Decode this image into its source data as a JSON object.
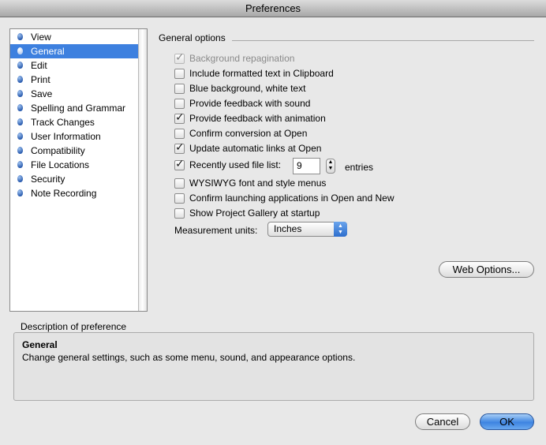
{
  "window": {
    "title": "Preferences"
  },
  "sidebar": {
    "items": [
      {
        "label": "View"
      },
      {
        "label": "General",
        "selected": true
      },
      {
        "label": "Edit"
      },
      {
        "label": "Print"
      },
      {
        "label": "Save"
      },
      {
        "label": "Spelling and Grammar"
      },
      {
        "label": "Track Changes"
      },
      {
        "label": "User Information"
      },
      {
        "label": "Compatibility"
      },
      {
        "label": "File Locations"
      },
      {
        "label": "Security"
      },
      {
        "label": "Note Recording"
      }
    ]
  },
  "general": {
    "group_title": "General options",
    "options": [
      {
        "label": "Background repagination",
        "checked": true,
        "disabled": true
      },
      {
        "label": "Include formatted text in Clipboard",
        "checked": false
      },
      {
        "label": "Blue background, white text",
        "checked": false
      },
      {
        "label": "Provide feedback with sound",
        "checked": false
      },
      {
        "label": "Provide feedback with animation",
        "checked": true
      },
      {
        "label": "Confirm conversion at Open",
        "checked": false
      },
      {
        "label": "Update automatic links at Open",
        "checked": true
      },
      {
        "label": "Recently used file list:",
        "checked": true
      },
      {
        "label": "WYSIWYG font and style menus",
        "checked": false
      },
      {
        "label": "Confirm launching applications in Open and New",
        "checked": false
      },
      {
        "label": "Show Project Gallery at startup",
        "checked": false
      }
    ],
    "recent_files_count": "9",
    "entries_label": "entries",
    "measurement_label": "Measurement units:",
    "measurement_value": "Inches",
    "web_options_button": "Web Options..."
  },
  "description": {
    "label": "Description of preference",
    "title": "General",
    "text": "Change general settings, such as some menu, sound, and appearance options."
  },
  "buttons": {
    "cancel": "Cancel",
    "ok": "OK"
  },
  "colors": {
    "selection": "#3d80df",
    "default_button": "#3d84e1"
  },
  "icons": {
    "list_bullet": "blue-dot-icon",
    "stepper": "up-down-arrows-icon",
    "popup": "up-down-arrows-icon"
  }
}
